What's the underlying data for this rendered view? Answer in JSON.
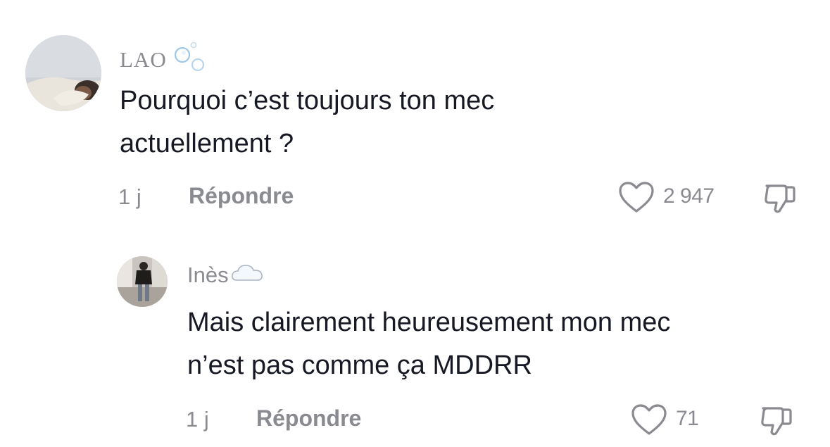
{
  "comments": [
    {
      "username": "LAO",
      "username_emoji": "bubbles-icon",
      "text_line1": "Pourquoi c’est toujours ton mec",
      "text_line2": "actuellement ?",
      "time": "1 j",
      "reply_label": "Répondre",
      "likes": "2 947",
      "avatar": "avatar-photo"
    },
    {
      "username": "Inès",
      "username_emoji": "cloud-icon",
      "text_line1": "Mais clairement heureusement mon mec",
      "text_line2": "n’est pas comme ça MDDRR",
      "time": "1 j",
      "reply_label": "Répondre",
      "likes": "71",
      "avatar": "avatar-photo"
    }
  ],
  "colors": {
    "text": "#161823",
    "muted": "#8a8b91",
    "background": "#ffffff"
  }
}
